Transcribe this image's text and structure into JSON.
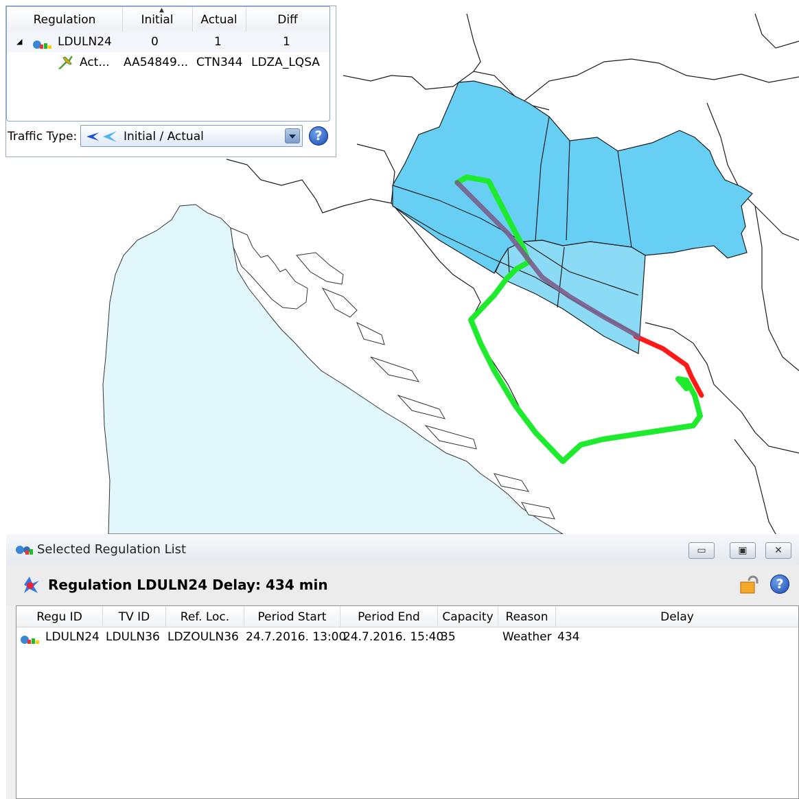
{
  "traffic_panel": {
    "columns": [
      "Regulation",
      "Initial",
      "Actual",
      "Diff"
    ],
    "regulation_row": {
      "name": "LDULN24",
      "initial": "0",
      "actual": "1",
      "diff": "1"
    },
    "flight_row": {
      "name": "Act...",
      "initial": "AA54849...",
      "actual": "CTN344",
      "diff": "LDZA_LQSA"
    },
    "traffic_type_label": "Traffic Type:",
    "traffic_type_value": "Initial / Actual",
    "help_label": "?"
  },
  "map": {
    "sea_color": "#e1f7fc",
    "sector_color": "#66cff3",
    "initial_route_color": "#7b5e8c",
    "regulated_route_color": "#ff1a1a",
    "actual_route_color": "#1eea2e"
  },
  "regulation_window": {
    "title": "Selected Regulation List",
    "header": "Regulation LDULN24 Delay: 434 min",
    "help_label": "?",
    "columns": [
      "Regu ID",
      "TV ID",
      "Ref. Loc.",
      "Period Start",
      "Period End",
      "Capacity",
      "Reason",
      "Delay"
    ],
    "rows": [
      {
        "regu_id": "LDULN24",
        "tv_id": "LDULN36",
        "ref_loc": "LDZOULN36",
        "period_start": "24.7.2016. 13:00",
        "period_end": "24.7.2016. 15:40",
        "capacity": "35",
        "reason": "Weather",
        "delay": "434"
      }
    ]
  }
}
